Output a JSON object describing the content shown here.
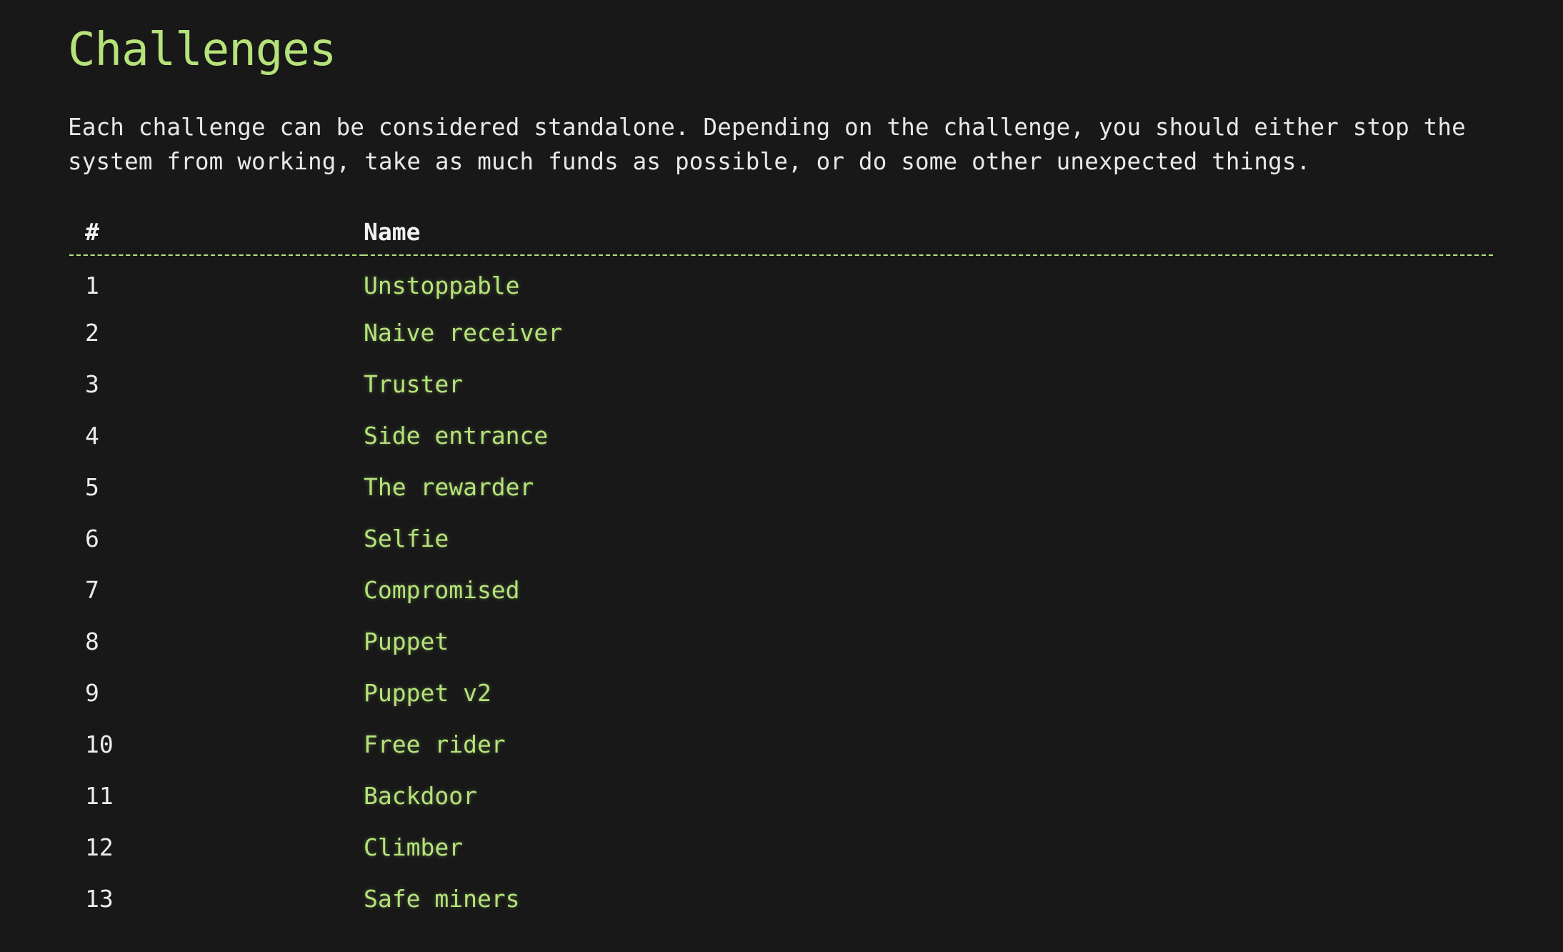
{
  "page": {
    "title": "Challenges",
    "intro_lines": [
      "Each challenge can be considered standalone. Depending on the challenge, you should either stop the",
      "system from working, take as much funds as possible, or do some other unexpected things."
    ]
  },
  "table": {
    "headers": {
      "number": "#",
      "name": "Name"
    },
    "rows": [
      {
        "number": "1",
        "name": "Unstoppable"
      },
      {
        "number": "2",
        "name": "Naive receiver"
      },
      {
        "number": "3",
        "name": "Truster"
      },
      {
        "number": "4",
        "name": "Side entrance"
      },
      {
        "number": "5",
        "name": "The rewarder"
      },
      {
        "number": "6",
        "name": "Selfie"
      },
      {
        "number": "7",
        "name": "Compromised"
      },
      {
        "number": "8",
        "name": "Puppet"
      },
      {
        "number": "9",
        "name": "Puppet v2"
      },
      {
        "number": "10",
        "name": "Free rider"
      },
      {
        "number": "11",
        "name": "Backdoor"
      },
      {
        "number": "12",
        "name": "Climber"
      },
      {
        "number": "13",
        "name": "Safe miners"
      }
    ]
  },
  "colors": {
    "background": "#181818",
    "accent": "#b5e37a",
    "text": "#e8e8e8"
  }
}
